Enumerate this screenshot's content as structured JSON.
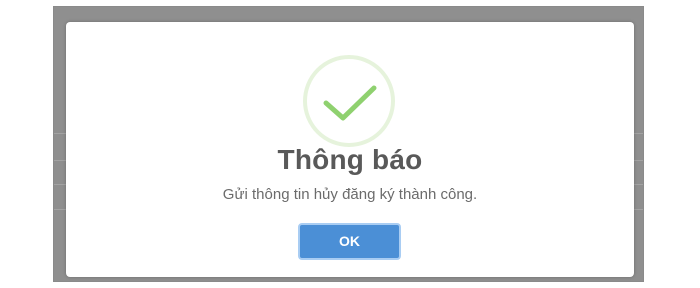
{
  "dialog": {
    "icon": "success-check-icon",
    "title": "Thông báo",
    "message": "Gửi thông tin hủy đăng ký thành công.",
    "ok_label": "OK"
  },
  "colors": {
    "overlay": "#8f8f8f",
    "dialog_background": "#ffffff",
    "success_ring": "#e6f3dc",
    "success_check": "#8fd16f",
    "title_text": "#595959",
    "message_text": "#6b6b6b",
    "button_background": "#4b8fd6",
    "button_border": "#a9cdf3",
    "button_text": "#ffffff"
  }
}
